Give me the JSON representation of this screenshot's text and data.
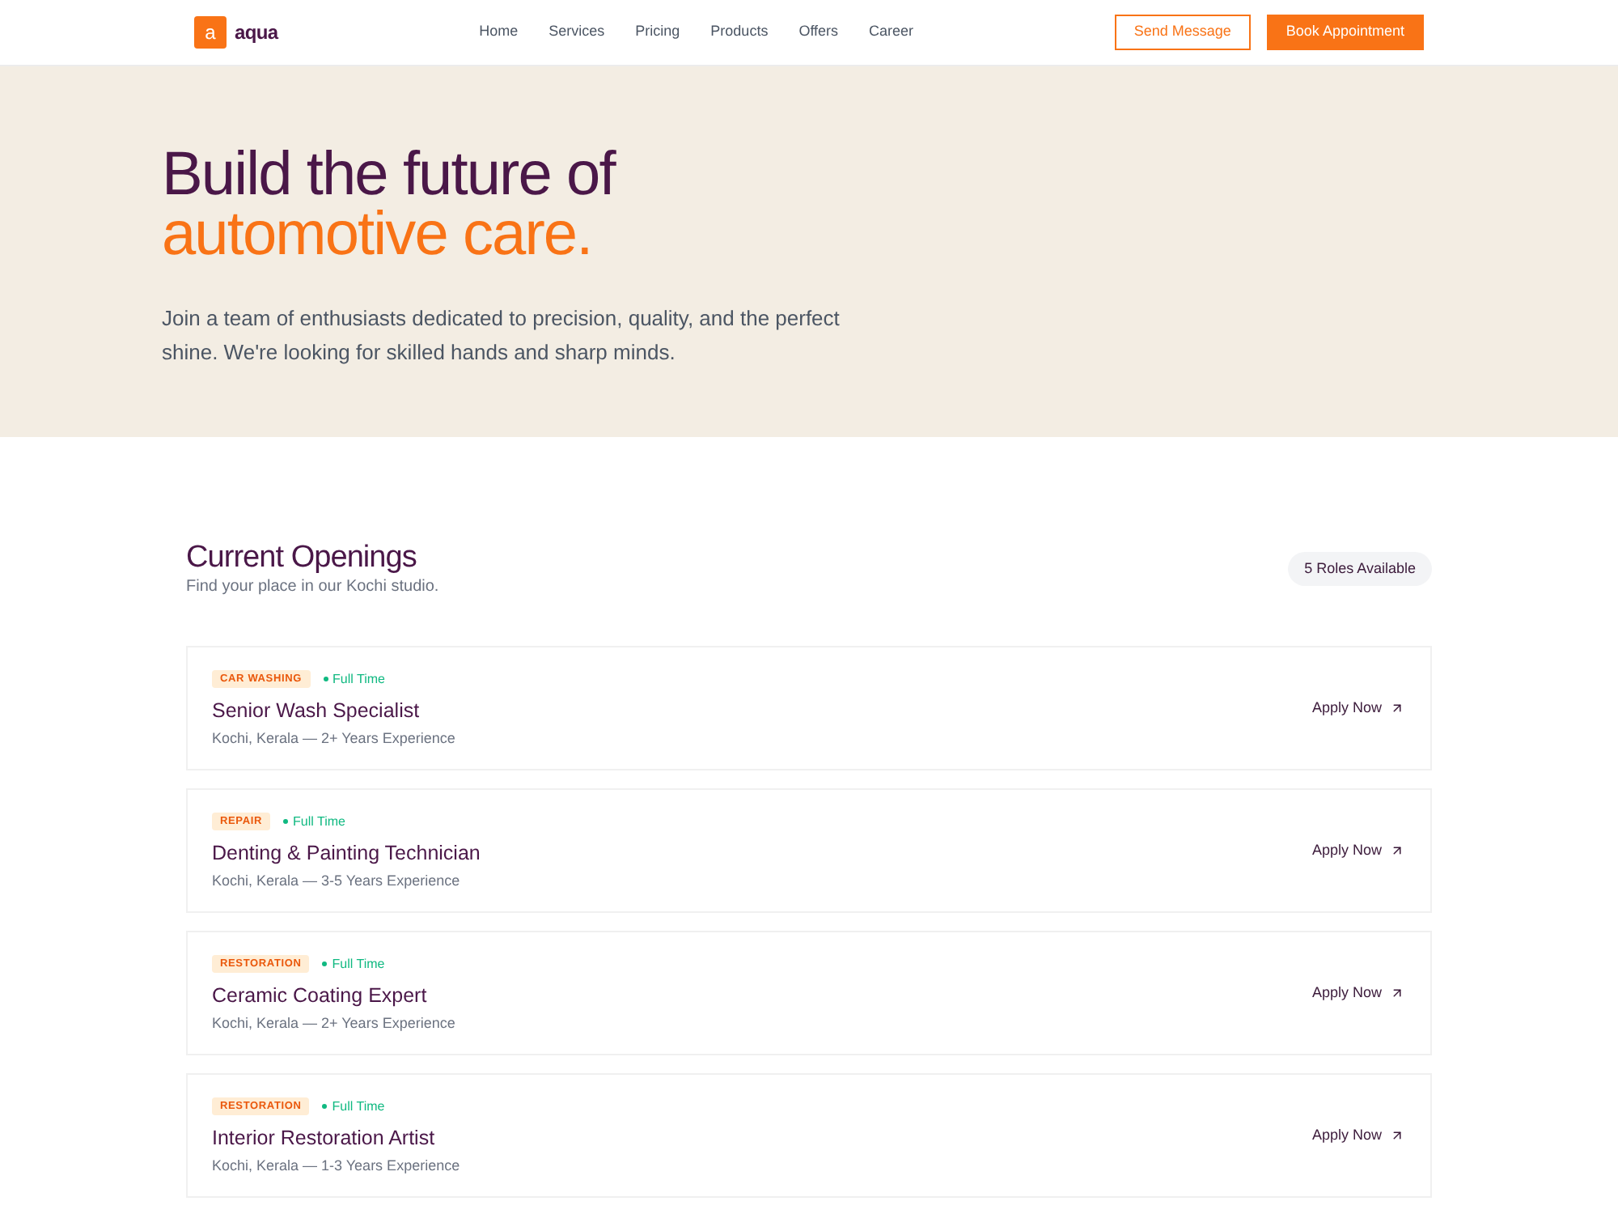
{
  "header": {
    "logo": {
      "mark": "a",
      "name": "aqua"
    },
    "nav": [
      {
        "label": "Home"
      },
      {
        "label": "Services"
      },
      {
        "label": "Pricing"
      },
      {
        "label": "Products"
      },
      {
        "label": "Offers"
      },
      {
        "label": "Career"
      }
    ],
    "buttons": [
      {
        "label": "Send Message",
        "kind": "outline"
      },
      {
        "label": "Book Appointment",
        "kind": "solid"
      }
    ]
  },
  "hero": {
    "title_line_1": "Build the future of",
    "title_line_2": "automotive care.",
    "description": "Join a team of enthusiasts dedicated to precision, quality, and the perfect shine. We're looking for skilled hands and sharp minds."
  },
  "openings": {
    "title": "Current Openings",
    "subtitle": "Find your place in our Kochi studio.",
    "count_badge": "5 Roles Available",
    "jobs": [
      {
        "category": "CAR WASHING",
        "type": "Full Time",
        "title": "Senior Wash Specialist",
        "meta": "Kochi, Kerala — 2+ Years Experience",
        "action": "Apply Now"
      },
      {
        "category": "REPAIR",
        "type": "Full Time",
        "title": "Denting & Painting Technician",
        "meta": "Kochi, Kerala — 3-5 Years Experience",
        "action": "Apply Now"
      },
      {
        "category": "RESTORATION",
        "type": "Full Time",
        "title": "Ceramic Coating Expert",
        "meta": "Kochi, Kerala — 2+ Years Experience",
        "action": "Apply Now"
      },
      {
        "category": "RESTORATION",
        "type": "Full Time",
        "title": "Interior Restoration Artist",
        "meta": "Kochi, Kerala — 1-3 Years Experience",
        "action": "Apply Now"
      }
    ]
  }
}
